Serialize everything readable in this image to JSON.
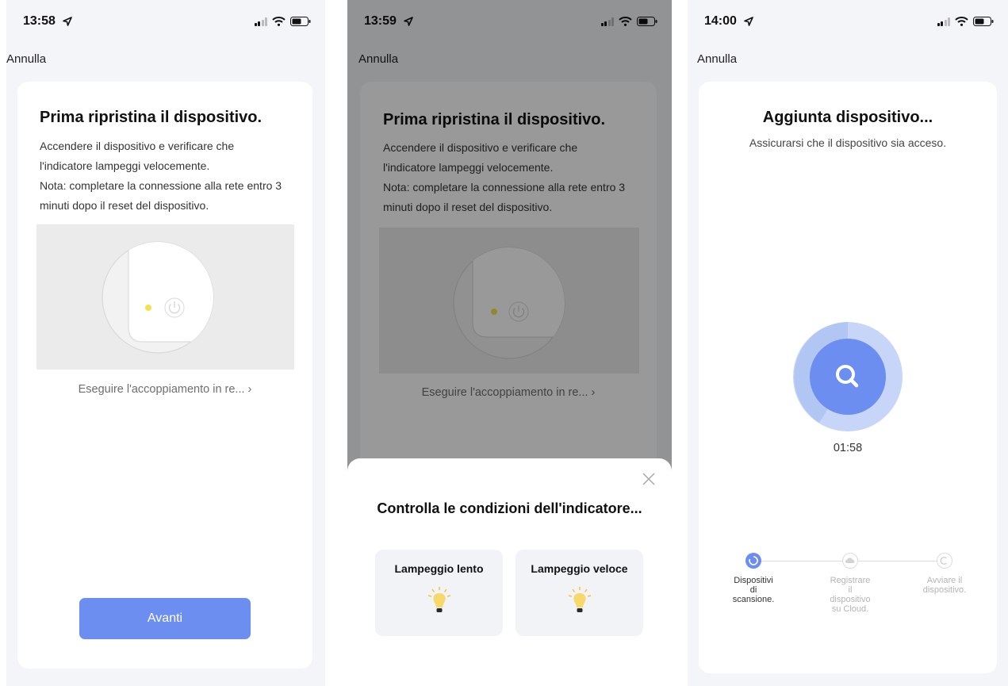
{
  "screens": [
    {
      "status_time": "13:58",
      "cancel_label": "Annulla",
      "title": "Prima ripristina il dispositivo.",
      "desc_lines": [
        "Accendere il dispositivo e verificare che",
        "l'indicatore lampeggi velocemente.",
        "Nota: completare la connessione alla rete entro 3",
        "minuti dopo il reset del dispositivo."
      ],
      "pair_link": "Eseguire l'accoppiamento in re... ›",
      "next_label": "Avanti"
    },
    {
      "status_time": "13:59",
      "cancel_label": "Annulla",
      "title": "Prima ripristina il dispositivo.",
      "desc_lines": [
        "Accendere il dispositivo e verificare che",
        "l'indicatore lampeggi velocemente.",
        "Nota: completare la connessione alla rete entro 3",
        "minuti dopo il reset del dispositivo."
      ],
      "pair_link": "Eseguire l'accoppiamento in re... ›",
      "sheet": {
        "title": "Controlla le condizioni dell'indicatore...",
        "options": [
          {
            "label": "Lampeggio lento",
            "icon": "lightbulb-icon"
          },
          {
            "label": "Lampeggio veloce",
            "icon": "lightbulb-icon"
          }
        ]
      }
    },
    {
      "status_time": "14:00",
      "cancel_label": "Annulla",
      "title": "Aggiunta dispositivo...",
      "subtitle": "Assicurarsi che il dispositivo sia acceso.",
      "timer": "01:58",
      "steps": [
        {
          "lines": [
            "Dispositivi",
            "di",
            "scansione."
          ],
          "state": "active"
        },
        {
          "lines": [
            "Registrare",
            "il",
            "dispositivo",
            "su Cloud."
          ],
          "state": "pending"
        },
        {
          "lines": [
            "Avviare il",
            "dispositivo."
          ],
          "state": "pending"
        }
      ]
    }
  ],
  "colors": {
    "accent": "#6b8ef0",
    "background": "#f4f5f8",
    "card": "#ffffff",
    "led": "#f2e34a",
    "scan_outer": "#c7d6f8",
    "scan_inner": "#6b8ef0"
  }
}
